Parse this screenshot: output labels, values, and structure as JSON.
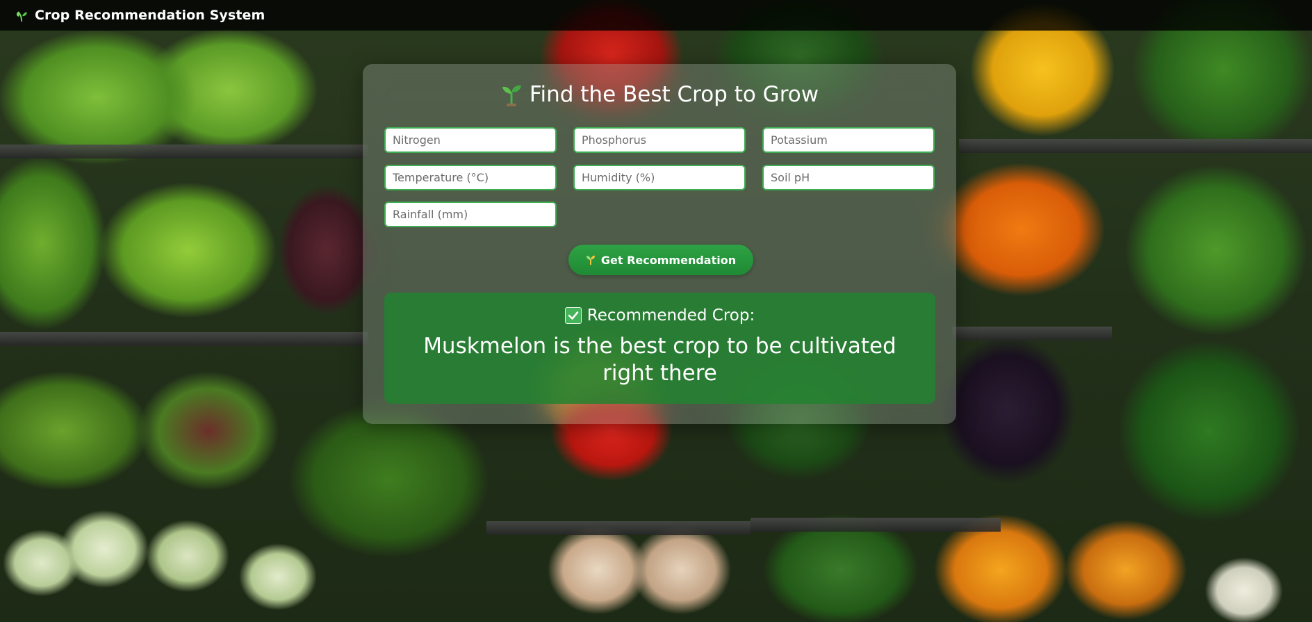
{
  "app": {
    "title": "Crop Recommendation System"
  },
  "form": {
    "heading": "Find the Best Crop to Grow",
    "fields": {
      "nitrogen": {
        "placeholder": "Nitrogen",
        "value": ""
      },
      "phosphorus": {
        "placeholder": "Phosphorus",
        "value": ""
      },
      "potassium": {
        "placeholder": "Potassium",
        "value": ""
      },
      "temperature": {
        "placeholder": "Temperature (°C)",
        "value": ""
      },
      "humidity": {
        "placeholder": "Humidity (%)",
        "value": ""
      },
      "ph": {
        "placeholder": "Soil pH",
        "value": ""
      },
      "rainfall": {
        "placeholder": "Rainfall (mm)",
        "value": ""
      }
    },
    "submit_label": "Get Recommendation"
  },
  "result": {
    "heading": "Recommended Crop:",
    "text": "Muskmelon is the best crop to be cultivated right there"
  },
  "icons": {
    "brand": "leaf-icon",
    "heading": "seedling-icon",
    "submit": "sprout-icon",
    "result": "checkmark-icon"
  },
  "colors": {
    "accent_green": "#2ea244",
    "result_green": "#228230",
    "topbar": "#000000"
  }
}
